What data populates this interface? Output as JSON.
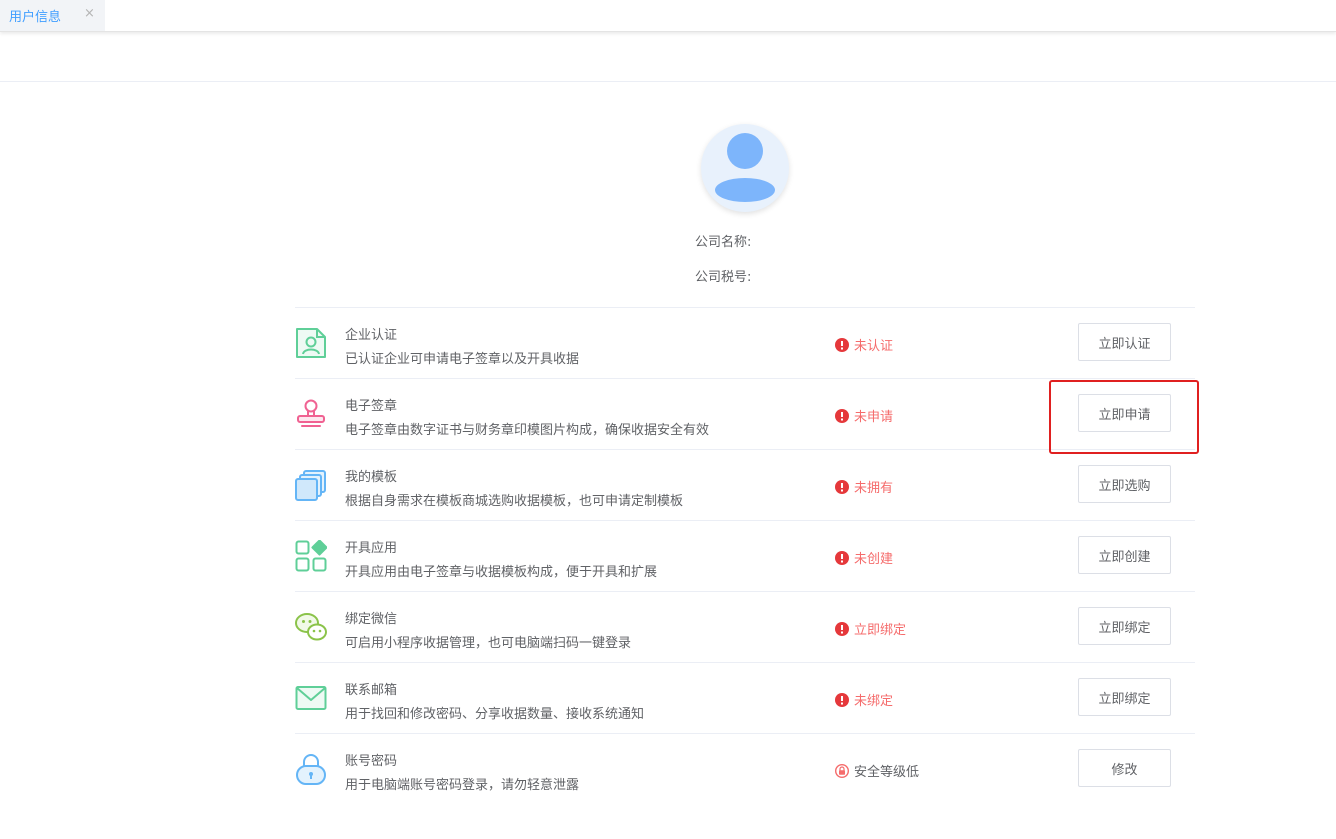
{
  "tab": {
    "label": "用户信息",
    "close": "×"
  },
  "profile": {
    "company_name_label": "公司名称:",
    "company_tax_label": "公司税号:"
  },
  "items": [
    {
      "title": "企业认证",
      "desc": "已认证企业可申请电子签章以及开具收据",
      "status": "未认证",
      "button": "立即认证",
      "icon": "certificate-icon"
    },
    {
      "title": "电子签章",
      "desc": "电子签章由数字证书与财务章印模图片构成，确保收据安全有效",
      "status": "未申请",
      "button": "立即申请",
      "icon": "stamp-icon"
    },
    {
      "title": "我的模板",
      "desc": "根据自身需求在模板商城选购收据模板，也可申请定制模板",
      "status": "未拥有",
      "button": "立即选购",
      "icon": "template-icon"
    },
    {
      "title": "开具应用",
      "desc": "开具应用由电子签章与收据模板构成，便于开具和扩展",
      "status": "未创建",
      "button": "立即创建",
      "icon": "apps-icon"
    },
    {
      "title": "绑定微信",
      "desc": "可启用小程序收据管理，也可电脑端扫码一键登录",
      "status": "立即绑定",
      "button": "立即绑定",
      "icon": "wechat-icon"
    },
    {
      "title": "联系邮箱",
      "desc": "用于找回和修改密码、分享收据数量、接收系统通知",
      "status": "未绑定",
      "button": "立即绑定",
      "icon": "mail-icon"
    },
    {
      "title": "账号密码",
      "desc": "用于电脑端账号密码登录，请勿轻意泄露",
      "status": "安全等级低",
      "button": "修改",
      "icon": "lock-icon"
    }
  ],
  "colors": {
    "accent": "#409eff",
    "warning": "#f56c6c",
    "highlight": "#e02020"
  }
}
